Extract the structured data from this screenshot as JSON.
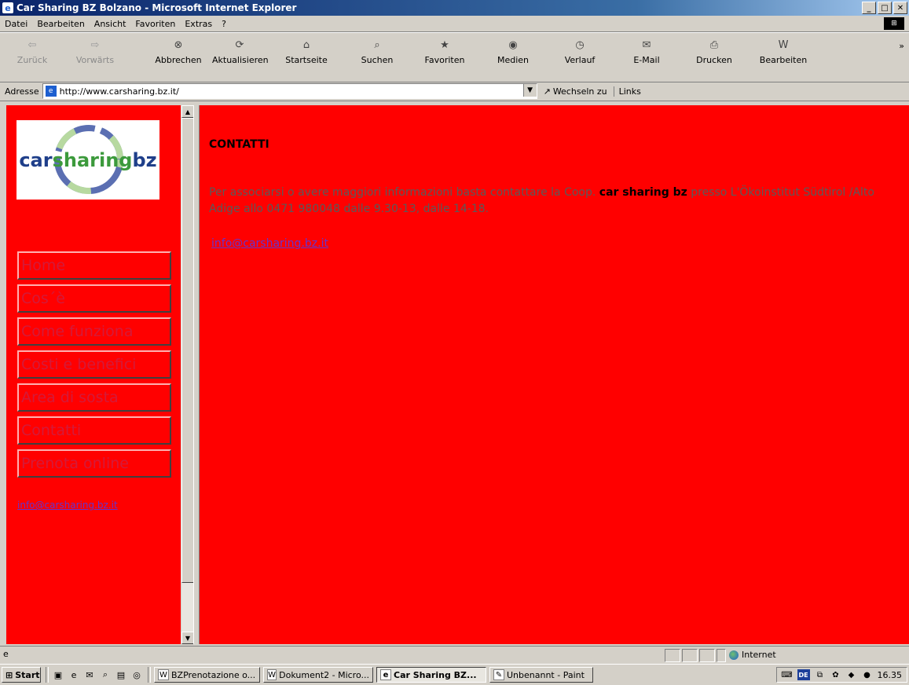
{
  "window": {
    "title": "Car Sharing BZ Bolzano - Microsoft Internet Explorer"
  },
  "menu": [
    "Datei",
    "Bearbeiten",
    "Ansicht",
    "Favoriten",
    "Extras",
    "?"
  ],
  "toolbar": {
    "back": "Zurück",
    "forward": "Vorwärts",
    "stop": "Abbrechen",
    "refresh": "Aktualisieren",
    "home": "Startseite",
    "search": "Suchen",
    "favorites": "Favoriten",
    "media": "Medien",
    "history": "Verlauf",
    "mail": "E-Mail",
    "print": "Drucken",
    "edit": "Bearbeiten"
  },
  "address": {
    "label": "Adresse",
    "url": "http://www.carsharing.bz.it/",
    "go": "Wechseln zu",
    "links": "Links"
  },
  "logo": {
    "part1": "car",
    "part2": "sharing",
    "part3": "bz"
  },
  "nav": {
    "items": [
      {
        "label": "Home"
      },
      {
        "label": "Cos´è"
      },
      {
        "label": "Come funziona"
      },
      {
        "label": "Costi e benefici"
      },
      {
        "label": "Area di sosta"
      },
      {
        "label": "Contatti"
      },
      {
        "label": "Prenota online"
      }
    ],
    "email": "info@carsharing.bz.it"
  },
  "content": {
    "heading": "CONTATTI",
    "para_pre": "Per associarsi o avere maggiori informazioni basta contattare la Coop.",
    "para_bold": "car sharing bz",
    "para_post": "presso L'Ökoinstitut Südtirol /Alto Adige allo 0471 980048 dalle 9.30-13, dalle 14-18.",
    "email": "info@carsharing.bz.it"
  },
  "status": {
    "zone": "Internet"
  },
  "taskbar": {
    "start": "Start",
    "tasks": [
      "BZPrenotazione o...",
      "Dokument2 - Micro...",
      "Car Sharing BZ...",
      "Unbenannt - Paint"
    ],
    "clock": "16.35",
    "lang": "DE"
  }
}
